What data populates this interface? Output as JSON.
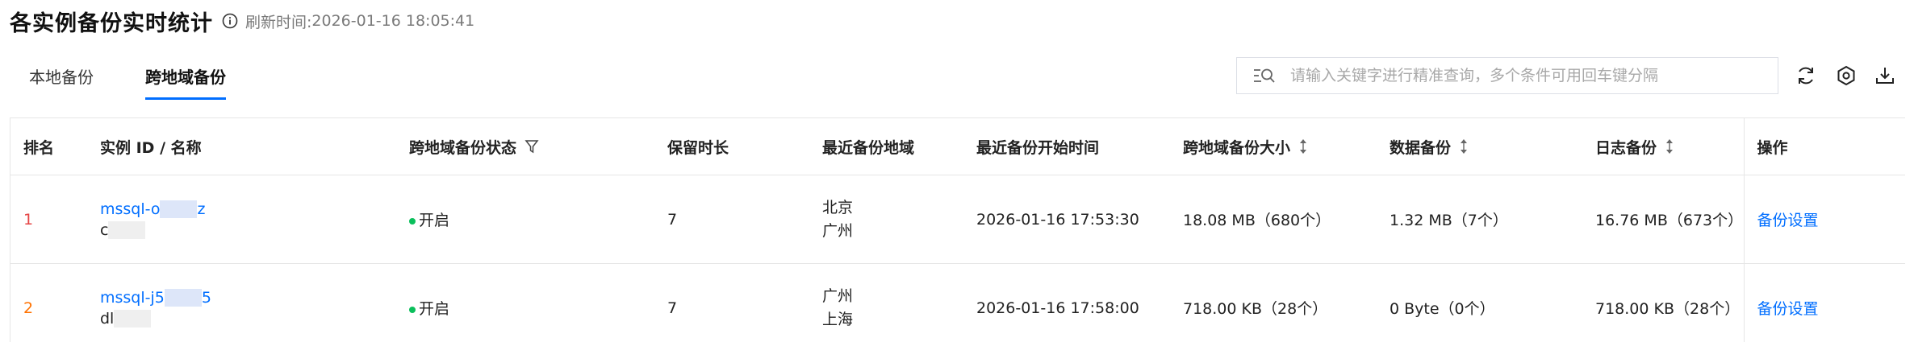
{
  "header": {
    "title": "各实例备份实时统计",
    "info_icon": "info-circle-icon",
    "refresh_label": "刷新时间:",
    "refresh_time": "2026-01-16 18:05:41"
  },
  "tabs": [
    {
      "label": "本地备份",
      "active": false
    },
    {
      "label": "跨地域备份",
      "active": true
    }
  ],
  "search": {
    "icon": "search-filter-icon",
    "placeholder": "请输入关键字进行精准查询，多个条件可用回车键分隔",
    "value": ""
  },
  "toolbar": {
    "refresh_icon": "refresh-icon",
    "settings_icon": "settings-icon",
    "download_icon": "download-icon"
  },
  "colors": {
    "accent": "#006eff",
    "status_on": "#0abf5b",
    "rank_1": "#e54545",
    "rank_2": "#ff7200"
  },
  "table": {
    "columns": [
      {
        "label": "排名"
      },
      {
        "label": "实例 ID / 名称"
      },
      {
        "label": "跨地域备份状态",
        "icon": "filter-icon"
      },
      {
        "label": "保留时长"
      },
      {
        "label": "最近备份地域"
      },
      {
        "label": "最近备份开始时间"
      },
      {
        "label": "跨地域备份大小",
        "icon": "sort-icon"
      },
      {
        "label": "数据备份",
        "icon": "sort-icon"
      },
      {
        "label": "日志备份",
        "icon": "sort-icon"
      },
      {
        "label": "操作"
      }
    ],
    "rows": [
      {
        "rank": "1",
        "instance_id": "mssql-o",
        "instance_id_tail": "z",
        "instance_name": "c",
        "status": "开启",
        "retention": "7",
        "regions": [
          "北京",
          "广州"
        ],
        "start_time": "2026-01-16 17:53:30",
        "cross_size": "18.08 MB（680个）",
        "data_backup": "1.32 MB（7个）",
        "log_backup": "16.76 MB（673个）",
        "action": "备份设置"
      },
      {
        "rank": "2",
        "instance_id": "mssql-j5",
        "instance_id_tail": "5",
        "instance_name": "dl",
        "status": "开启",
        "retention": "7",
        "regions": [
          "广州",
          "上海"
        ],
        "start_time": "2026-01-16 17:58:00",
        "cross_size": "718.00 KB（28个）",
        "data_backup": "0 Byte（0个）",
        "log_backup": "718.00 KB（28个）",
        "action": "备份设置"
      }
    ]
  }
}
